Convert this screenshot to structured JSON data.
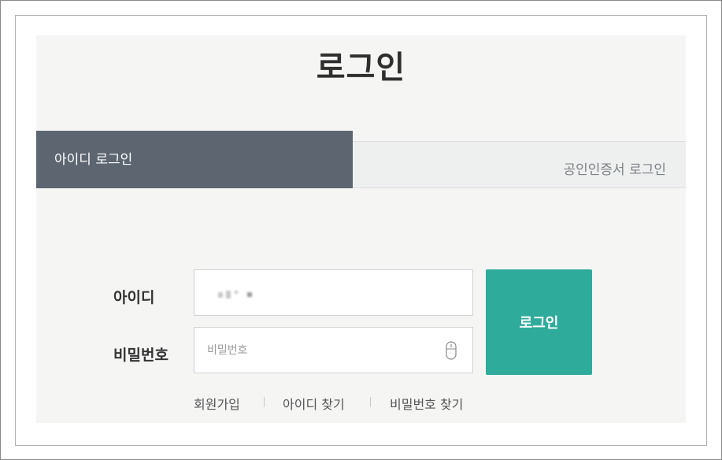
{
  "page": {
    "title": "로그인"
  },
  "tabs": [
    {
      "label": "아이디 로그인",
      "active": true
    },
    {
      "label": "공인인증서 로그인",
      "active": false
    }
  ],
  "form": {
    "id_label": "아이디",
    "password_label": "비밀번호",
    "password_placeholder": "비밀번호",
    "submit_label": "로그인"
  },
  "links": {
    "join": "회원가입",
    "find_id": "아이디 찾기",
    "find_password": "비밀번호 찾기"
  },
  "icons": {
    "password_field_icon": "mouse-icon"
  },
  "colors": {
    "active_tab": "#5c6570",
    "accent_button": "#2fab9c",
    "panel_background": "#f5f5f4"
  }
}
